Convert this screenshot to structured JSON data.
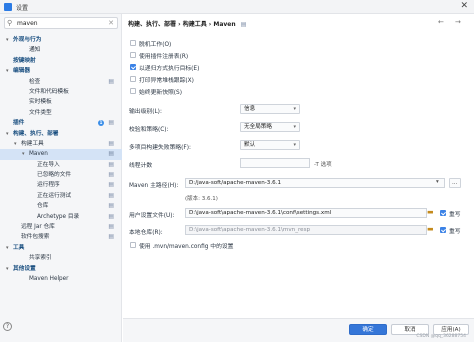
{
  "window": {
    "title": "设置",
    "close_glyph": "✕"
  },
  "search": {
    "value": "maven",
    "icon": "search-icon",
    "clear_glyph": "✕"
  },
  "tree": [
    {
      "label": "外观与行为",
      "level": 0,
      "arrow": "▾",
      "bold": true
    },
    {
      "label": "通知",
      "level": 2
    },
    {
      "label": "按键映射",
      "level": 0,
      "bold": true
    },
    {
      "label": "编辑器",
      "level": 0,
      "arrow": "▾",
      "bold": true
    },
    {
      "label": "检查",
      "level": 2,
      "mark": "▤"
    },
    {
      "label": "文件和代码模板",
      "level": 2,
      "mark": ""
    },
    {
      "label": "实时模板",
      "level": 2
    },
    {
      "label": "文件类型",
      "level": 2
    },
    {
      "label": "插件",
      "level": 0,
      "bold": true,
      "badge": "1",
      "mark": "▤"
    },
    {
      "label": "构建、执行、部署",
      "level": 0,
      "arrow": "▾",
      "bold": true
    },
    {
      "label": "构建工具",
      "level": 1,
      "arrow": "▾",
      "mark": "▤"
    },
    {
      "label": "Maven",
      "level": 2,
      "arrow": "▾",
      "mark": "▤",
      "selected": true
    },
    {
      "label": "正在导入",
      "level": 3,
      "mark": "▤"
    },
    {
      "label": "已忽略的文件",
      "level": 3,
      "mark": "▤"
    },
    {
      "label": "运行程序",
      "level": 3,
      "mark": "▤"
    },
    {
      "label": "正在运行测试",
      "level": 3,
      "mark": "▤"
    },
    {
      "label": "仓库",
      "level": 3,
      "mark": "▤"
    },
    {
      "label": "Archetype 目录",
      "level": 3,
      "mark": "▤"
    },
    {
      "label": "远程 Jar 仓库",
      "level": 1,
      "mark": "▤"
    },
    {
      "label": "软件包搜索",
      "level": 1,
      "mark": "▤"
    },
    {
      "label": "工具",
      "level": 0,
      "arrow": "▾",
      "bold": true
    },
    {
      "label": "共享索引",
      "level": 2
    },
    {
      "label": "其他设置",
      "level": 0,
      "arrow": "▾",
      "bold": true
    },
    {
      "label": "Maven Helper",
      "level": 2
    }
  ],
  "breadcrumb": {
    "parts": [
      "构建、执行、部署",
      "构建工具",
      "Maven"
    ],
    "sep": "›",
    "mark": "▤"
  },
  "nav": {
    "back": "←",
    "forward": "→"
  },
  "checkboxes": [
    {
      "label": "脱机工作(O)",
      "checked": false
    },
    {
      "label": "使用插件注册表(R)",
      "checked": false
    },
    {
      "label": "以递归方式执行目标(E)",
      "checked": true
    },
    {
      "label": "打印异常堆栈跟踪(X)",
      "checked": false
    },
    {
      "label": "始终更新快照(S)",
      "checked": false
    }
  ],
  "selects": [
    {
      "label": "输出级别(L):",
      "value": "信息"
    },
    {
      "label": "校验和策略(C):",
      "value": "无全局策略"
    },
    {
      "label": "多项目构建失败策略(F):",
      "value": "默认"
    }
  ],
  "threads": {
    "label": "线程计数",
    "value": "",
    "hint": "-T 选项"
  },
  "maven_home": {
    "label": "Maven 主路径(H):",
    "value": "D:/java-soft/apache-maven-3.6.1",
    "version": "(版本: 3.6.1)",
    "browse": "..."
  },
  "user_settings": {
    "label": "用户设置文件(U):",
    "value": "D:\\java-soft\\apache-maven-3.6.1\\conf\\settings.xml",
    "override_label": "重写",
    "override": true
  },
  "local_repo": {
    "label": "本地仓库(R):",
    "value": "D:\\java-soft\\apache-maven-3.6.1\\mvn_resp",
    "override_label": "重写",
    "override": true
  },
  "mvn_config": {
    "label": "使用 .mvn/maven.config 中的设置",
    "checked": false
  },
  "footer": {
    "ok": "确定",
    "cancel": "取消",
    "apply": "应用(A)",
    "help": "?"
  },
  "watermark": "CSDN @qq_36288754"
}
